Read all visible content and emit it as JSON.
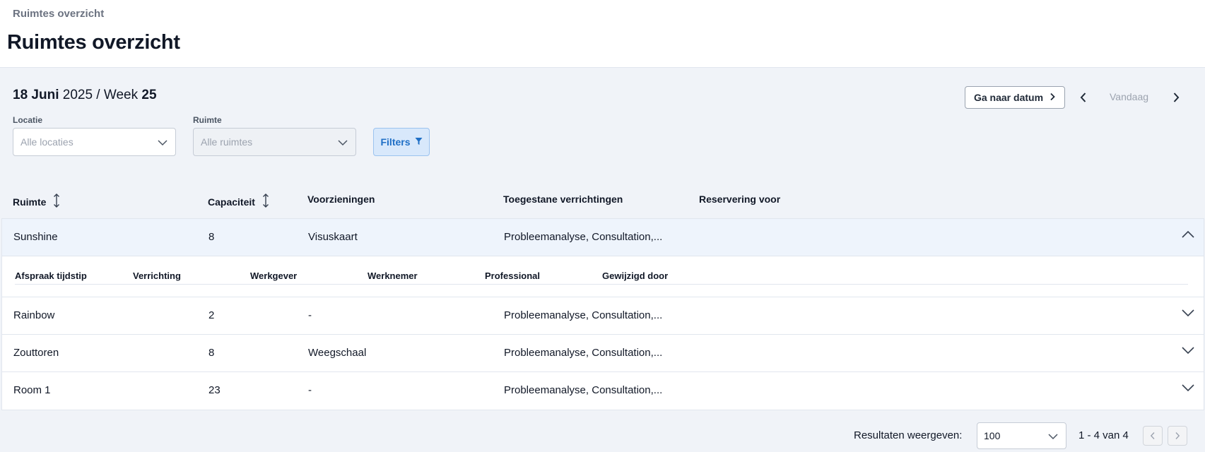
{
  "breadcrumb": "Ruimtes overzicht",
  "page_title": "Ruimtes overzicht",
  "date": {
    "day": "18 Juni",
    "rest": " 2025 / Week ",
    "week": "25"
  },
  "toolbar": {
    "goto_date": "Ga naar datum",
    "today": "Vandaag"
  },
  "filters": {
    "location_label": "Locatie",
    "location_placeholder": "Alle locaties",
    "room_label": "Ruimte",
    "room_placeholder": "Alle ruimtes",
    "filters_button": "Filters"
  },
  "columns": {
    "room": "Ruimte",
    "capacity": "Capaciteit",
    "facilities": "Voorzieningen",
    "allowed": "Toegestane verrichtingen",
    "reservation": "Reservering voor"
  },
  "rows": [
    {
      "room": "Sunshine",
      "capacity": "8",
      "facilities": "Visuskaart",
      "allowed": "Probleemanalyse, Consultation,..."
    },
    {
      "room": "Rainbow",
      "capacity": "2",
      "facilities": "-",
      "allowed": "Probleemanalyse, Consultation,..."
    },
    {
      "room": "Zouttoren",
      "capacity": "8",
      "facilities": "Weegschaal",
      "allowed": "Probleemanalyse, Consultation,..."
    },
    {
      "room": "Room 1",
      "capacity": "23",
      "facilities": "-",
      "allowed": "Probleemanalyse, Consultation,..."
    }
  ],
  "detail_columns": {
    "time": "Afspraak tijdstip",
    "action": "Verrichting",
    "employer": "Werkgever",
    "employee": "Werknemer",
    "professional": "Professional",
    "modified_by": "Gewijzigd door"
  },
  "pagination": {
    "label": "Resultaten weergeven:",
    "page_size": "100",
    "range": "1 - 4 van 4"
  },
  "colors": {
    "accent": "#1f6fc6",
    "selected_row": "#eef4fc",
    "page_background": "#f0f3f8"
  }
}
